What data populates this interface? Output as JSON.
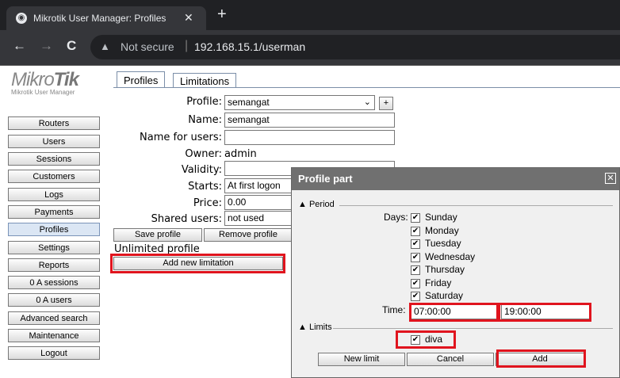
{
  "browser": {
    "tab_title": "Mikrotik User Manager: Profiles",
    "tab_close": "✕",
    "new_tab": "+",
    "back": "←",
    "forward": "→",
    "reload": "C",
    "security": "Not secure",
    "url": "192.168.15.1/userman"
  },
  "logo": {
    "brand_a": "Mikro",
    "brand_b": "Tik",
    "sub": "Mikrotik User Manager"
  },
  "sidebar": {
    "items": [
      "Routers",
      "Users",
      "Sessions",
      "Customers",
      "Logs",
      "Payments",
      "Profiles",
      "Settings",
      "Reports",
      "0 A sessions",
      "0 A users",
      "Advanced search",
      "Maintenance",
      "Logout"
    ],
    "active": "Profiles"
  },
  "tabs": [
    "Profiles",
    "Limitations"
  ],
  "form": {
    "profile_label": "Profile:",
    "profile_value": "semangat",
    "profile_add": "+",
    "name_label": "Name:",
    "name_value": "semangat",
    "name_for_users_label": "Name for users:",
    "name_for_users_value": "",
    "owner_label": "Owner:",
    "owner_value": "admin",
    "validity_label": "Validity:",
    "validity_value": "",
    "starts_label": "Starts:",
    "starts_value": "At first logon",
    "price_label": "Price:",
    "price_value": "0.00",
    "shared_label": "Shared users:",
    "shared_value": "not used",
    "save_profile": "Save profile",
    "remove_profile": "Remove profile",
    "unlimited_text": "Unlimited profile",
    "add_limitation": "Add new limitation"
  },
  "popup": {
    "title": "Profile part",
    "close": "✕",
    "period_label": "Period",
    "days_label": "Days:",
    "days": [
      "Sunday",
      "Monday",
      "Tuesday",
      "Wednesday",
      "Thursday",
      "Friday",
      "Saturday"
    ],
    "time_label": "Time:",
    "time_from": "07:00:00",
    "time_to": "19:00:00",
    "limits_label": "Limits",
    "limit_item": "diva",
    "new_limit": "New limit",
    "cancel": "Cancel",
    "add": "Add"
  },
  "colors": {
    "highlight": "#e0141e",
    "titlebar": "#707070"
  }
}
